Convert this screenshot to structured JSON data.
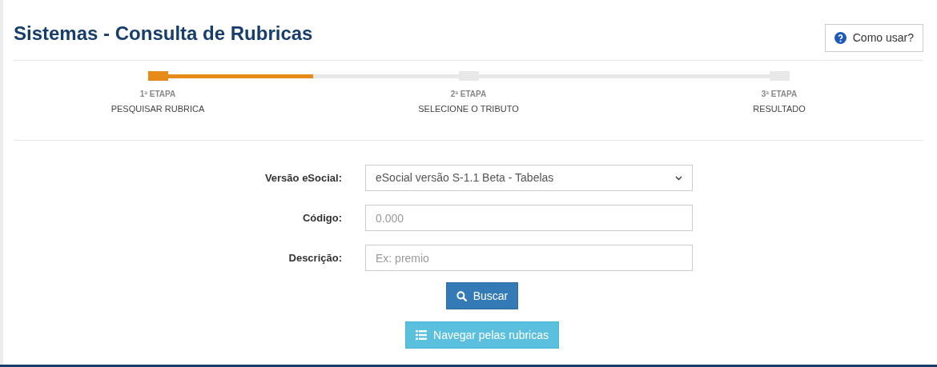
{
  "title": "Sistemas - Consulta de Rubricas",
  "help_button": {
    "label": "Como usar?"
  },
  "progress": {
    "level": 0.25
  },
  "steps": [
    {
      "number": "1ª ETAPA",
      "label": "PESQUISAR RUBRICA",
      "selected": true
    },
    {
      "number": "2ª ETAPA",
      "label": "SELECIONE O TRIBUTO",
      "selected": false
    },
    {
      "number": "3ª ETAPA",
      "label": "RESULTADO",
      "selected": false
    }
  ],
  "form": [
    {
      "kind": "select",
      "label": "Versão eSocial:",
      "value": "eSocial versão S-1.1 Beta - Tabelas"
    },
    {
      "kind": "input",
      "label": "Código:",
      "placeholder": "0.000"
    },
    {
      "kind": "input",
      "label": "Descrição:",
      "placeholder": "Ex: premio"
    }
  ],
  "search_button": {
    "label": "Buscar"
  },
  "browse_button": {
    "label": "Navegar pelas rubricas"
  }
}
